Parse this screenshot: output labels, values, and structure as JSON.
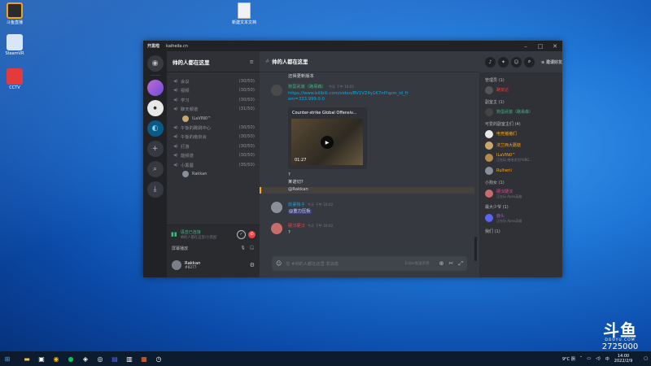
{
  "desktop": {
    "icons": [
      {
        "label": "斗鱼直播",
        "color": "#f3a11b"
      },
      {
        "label": "SteamVR",
        "color": "#5b8fd8"
      },
      {
        "label": "CCTV",
        "color": "#e33b3b"
      }
    ],
    "file": {
      "label": "新建文本文档"
    }
  },
  "window": {
    "title": "开黑啦",
    "domain": "kaiheila.cn",
    "controls": [
      "–",
      "□",
      "✕"
    ]
  },
  "server": {
    "name": "帅的人都在这里",
    "channels": [
      {
        "name": "会议",
        "count": "(30/50)"
      },
      {
        "name": "视频",
        "count": "(30/50)"
      },
      {
        "name": "学习",
        "count": "(30/50)"
      },
      {
        "name": "聊天频道",
        "count": "(31/50)"
      },
      {
        "name": "午饭的跳跳中心",
        "count": "(30/50)"
      },
      {
        "name": "午饭的南京会",
        "count": "(30/50)"
      },
      {
        "name": "打游",
        "count": "(30/50)"
      },
      {
        "name": "能频道",
        "count": "(30/50)"
      },
      {
        "name": "小黑屋",
        "count": "(35/50)"
      }
    ],
    "channel_members": [
      {
        "after": 3,
        "name": "ILaVIN0^"
      },
      {
        "after": 8,
        "name": "Rakkan"
      }
    ]
  },
  "voice": {
    "status": "语音已连接",
    "detail": "帅的人都在这里/小黑屋"
  },
  "share": {
    "label": "屏幕播放"
  },
  "user": {
    "name": "Rakkan",
    "tag": "#8277"
  },
  "chat": {
    "channel": "帅的人都在这里",
    "invite_label": "邀请好友",
    "messages": [
      {
        "name": "",
        "time": "",
        "text": "还得更新版本"
      },
      {
        "name": "狗蛋武装（路易森）",
        "name_color": "#43b581",
        "time": "今天 下午 16:01",
        "link": "https://www.bilibili.com/video/BV1VZ4y1K7nf?spm_id_from=333.999.0.0"
      },
      {
        "embed_title": "Counter-strike Global Offensiv...",
        "duration": "01:27"
      },
      {
        "text": "?"
      },
      {
        "text": "某诺切?"
      },
      {
        "text": "@Rakkan"
      },
      {
        "name": "前妻独子",
        "name_color": "#00aff4",
        "time": "今天 下午 16:02",
        "text": "@重力压板"
      },
      {
        "name": "硬汉硬汉",
        "name_color": "#ed4245",
        "time": "今天 下午 16:02",
        "text": "?"
      }
    ],
    "composer_placeholder": "在 #帅的人都在这里 发消息",
    "composer_hint": "Enter发送消息"
  },
  "members": {
    "roles": [
      {
        "name": "管理员 (1)",
        "members": [
          {
            "name": "路安达",
            "color": "#ed4245"
          }
        ]
      },
      {
        "name": "副室主 (1)",
        "members": [
          {
            "name": "狗蛋武装（路易森）",
            "color": "#43b581"
          }
        ]
      },
      {
        "name": "可爱的副室主们 (4)",
        "members": [
          {
            "name": "电竞猪猪们",
            "color": "#faa61a"
          },
          {
            "name": "法兰西大蘑菇",
            "color": "#faa61a"
          },
          {
            "name": "ILaVIN0^",
            "color": "#faa61a",
            "sub": "正在玩 绝地求生PUBG..."
          },
          {
            "name": "Rulherii",
            "color": "#faa61a"
          }
        ]
      },
      {
        "name": "小狗女 (1)",
        "members": [
          {
            "name": "硬汉硬汉",
            "color": "#eb459e",
            "sub": "正在玩 Apex英雄"
          }
        ]
      },
      {
        "name": "最大少爷 (1)",
        "members": [
          {
            "name": "鹿头",
            "color": "#9b59b6",
            "sub": "正在玩 Apex英雄"
          }
        ]
      },
      {
        "name": "我们 (1)",
        "members": []
      }
    ]
  },
  "taskbar": {
    "weather": "9°C 阴",
    "time": "14:00",
    "date": "2022/2/9",
    "lang": "中"
  },
  "watermark": {
    "logo": "斗鱼",
    "sub": "DOUYU.COM",
    "room_id": "2725000"
  }
}
